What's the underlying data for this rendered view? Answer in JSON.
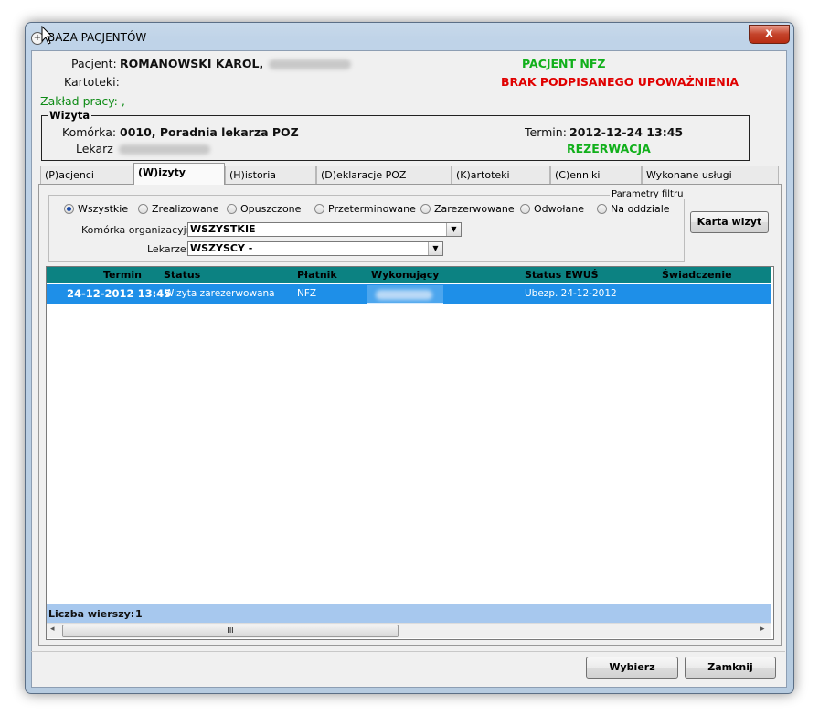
{
  "window": {
    "title": "BAZA PACJENTÓW",
    "close_glyph": "x"
  },
  "patient": {
    "label": "Pacjent:",
    "name": "ROMANOWSKI KAROL,",
    "kartoteki_label": "Kartoteki:",
    "zaklad_label": "Zakład pracy: ,",
    "nfz_status": "PACJENT NFZ",
    "auth_status": "BRAK PODPISANEGO UPOWAŻNIENIA"
  },
  "visit": {
    "group_title": "Wizyta",
    "komorka_label": "Komórka:",
    "komorka_value": "0010, Poradnia lekarza POZ",
    "lekarz_label": "Lekarz",
    "termin_label": "Termin:",
    "termin_value": "2012-12-24 13:45",
    "reservation": "REZERWACJA"
  },
  "tabs": [
    {
      "label": "(P)acjenci"
    },
    {
      "label": "(W)izyty"
    },
    {
      "label": "(H)istoria"
    },
    {
      "label": "(D)eklaracje POZ"
    },
    {
      "label": "(K)artoteki"
    },
    {
      "label": "(C)enniki"
    },
    {
      "label": "Wykonane usługi"
    }
  ],
  "filter": {
    "title": "Parametry filtru",
    "radios": [
      "Wszystkie",
      "Zrealizowane",
      "Opuszczone",
      "Przeterminowane",
      "Zarezerwowane",
      "Odwołane",
      "Na oddziale"
    ],
    "komorka_label": "Komórka organizacyjna:",
    "komorka_value": "WSZYSTKIE",
    "lekarze_label": "Lekarze:",
    "lekarze_value": "WSZYSCY  -",
    "karta_button": "Karta wizyt"
  },
  "grid": {
    "columns": [
      "Termin",
      "Status",
      "Płatnik",
      "Wykonujący",
      "Status EWUŚ",
      "Świadczenie"
    ],
    "rows": [
      {
        "termin": "24-12-2012 13:45",
        "status": "Wizyta zarezerwowana",
        "platnik": "NFZ",
        "ewus": "Ubezp.  24-12-2012"
      }
    ],
    "footer_label": "Liczba wierszy:",
    "footer_count": "1",
    "scroll_grip": "III",
    "left_arrow": "◂",
    "right_arrow": "▸"
  },
  "buttons": {
    "wybierz": "Wybierz",
    "zamknij": "Zamknij"
  },
  "colors": {
    "grid_header": "#0c8282",
    "selected_row": "#1e8fe8",
    "footer": "#a7c8ee",
    "ok_green": "#11b01b",
    "alert_red": "#e00000"
  }
}
